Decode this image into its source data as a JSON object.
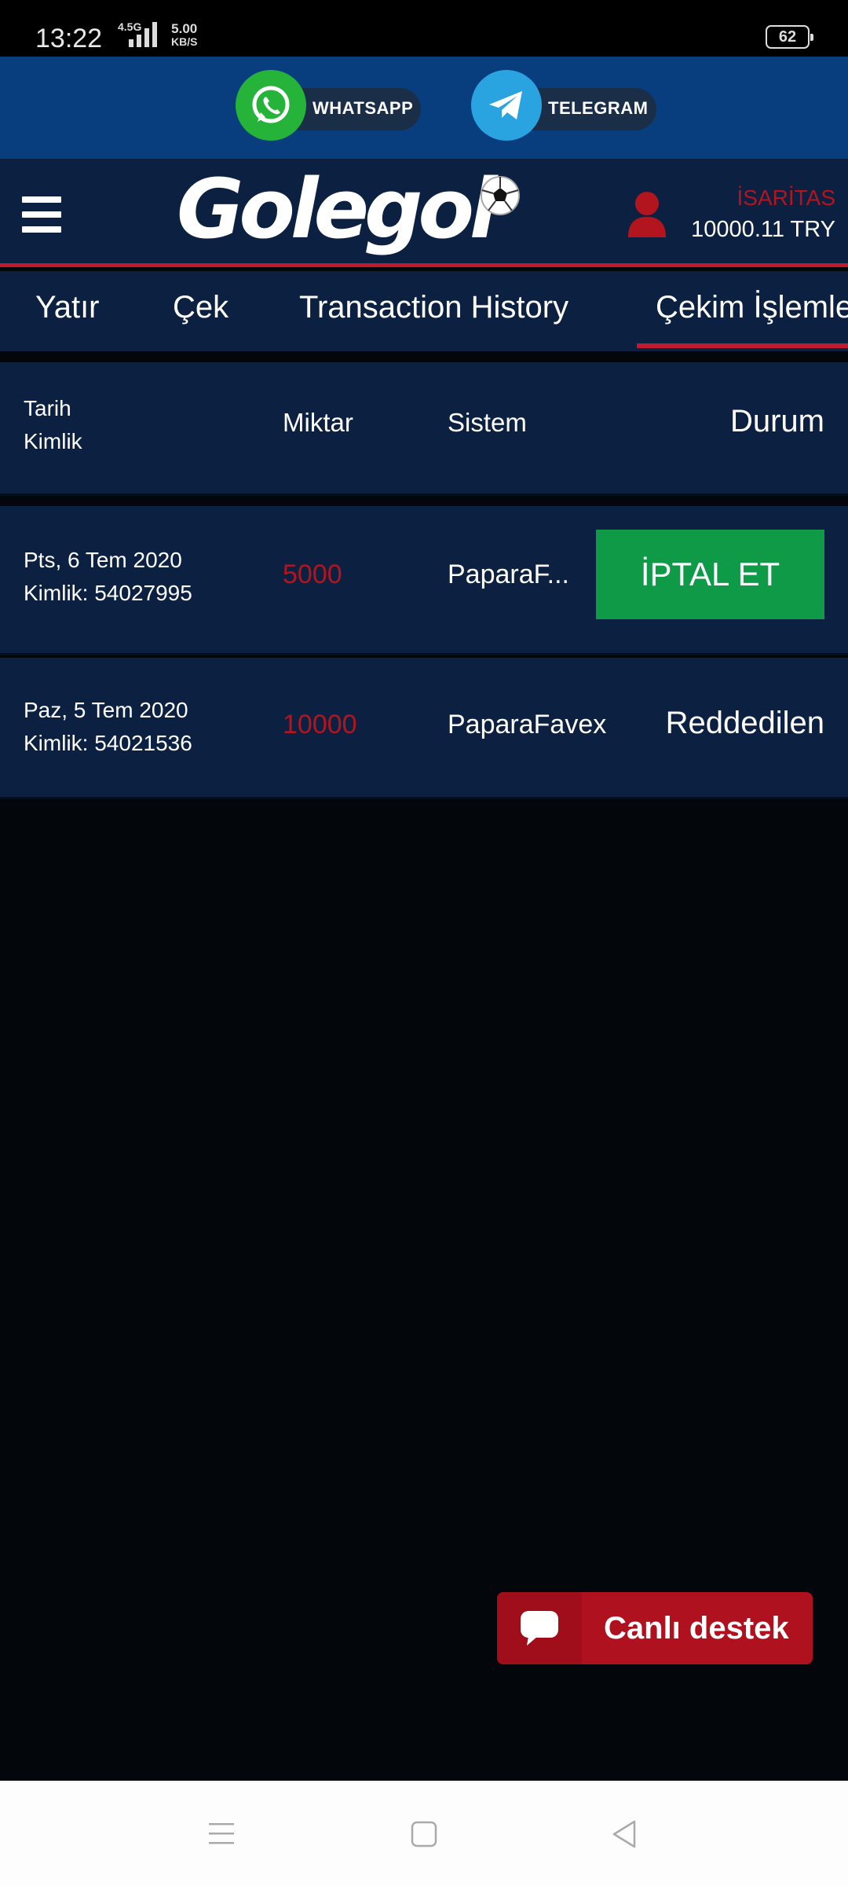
{
  "status_bar": {
    "time": "13:22",
    "network": "4.5G",
    "speed_value": "5.00",
    "speed_unit": "KB/S",
    "battery": "62"
  },
  "social": {
    "whatsapp_label": "WHATSAPP",
    "telegram_label": "TELEGRAM",
    "whatsapp_color": "#25b33a",
    "telegram_color": "#2aa4e0"
  },
  "header": {
    "logo_text": "Golegol",
    "username": "İSARİTAS",
    "balance": "10000.11 TRY"
  },
  "tabs": [
    {
      "label": "Yatır"
    },
    {
      "label": "Çek"
    },
    {
      "label": "Transaction History"
    },
    {
      "label": "Çekim İşlemleri",
      "active": true
    }
  ],
  "table": {
    "headers": {
      "date": "Tarih",
      "id": "Kimlik",
      "amount": "Miktar",
      "system": "Sistem",
      "status": "Durum"
    },
    "rows": [
      {
        "date": "Pts, 6 Tem 2020",
        "id": "Kimlik: 54027995",
        "amount": "5000",
        "system": "PaparaF...",
        "action": "İPTAL ET"
      },
      {
        "date": "Paz, 5 Tem 2020",
        "id": "Kimlik: 54021536",
        "amount": "10000",
        "system": "PaparaFavex",
        "status": "Reddedilen"
      }
    ]
  },
  "support": {
    "label": "Canlı destek"
  },
  "colors": {
    "brand_red": "#c21a2d",
    "navy": "#0c2141",
    "social_blue": "#083e7e",
    "success_green": "#0f9a48"
  }
}
